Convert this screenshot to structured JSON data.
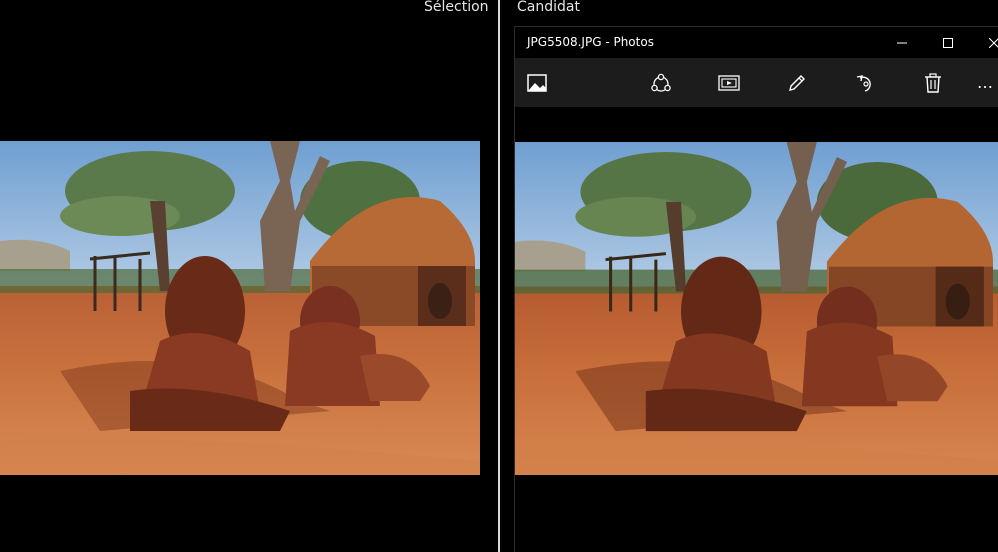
{
  "panes": {
    "left_label": "Sélection",
    "right_label": "Candidat"
  },
  "window": {
    "title": "JPG5508.JPG - Photos",
    "controls": {
      "minimize_icon": "minimize-icon",
      "maximize_icon": "maximize-icon",
      "close_icon": "close-icon"
    }
  },
  "toolbar": {
    "items": [
      {
        "name": "collection",
        "icon": "image-icon"
      },
      {
        "name": "share",
        "icon": "share-icon"
      },
      {
        "name": "slideshow",
        "icon": "slideshow-icon"
      },
      {
        "name": "edit",
        "icon": "pencil-icon"
      },
      {
        "name": "rotate",
        "icon": "rotate-icon"
      },
      {
        "name": "delete",
        "icon": "trash-icon"
      }
    ],
    "more_label": "…"
  },
  "colors": {
    "background": "#000000",
    "toolbar": "#1c1c1c",
    "divider": "#d9d9d9",
    "text": "#ffffff",
    "sand": "#c0622c",
    "sky": "#8fb7df"
  }
}
